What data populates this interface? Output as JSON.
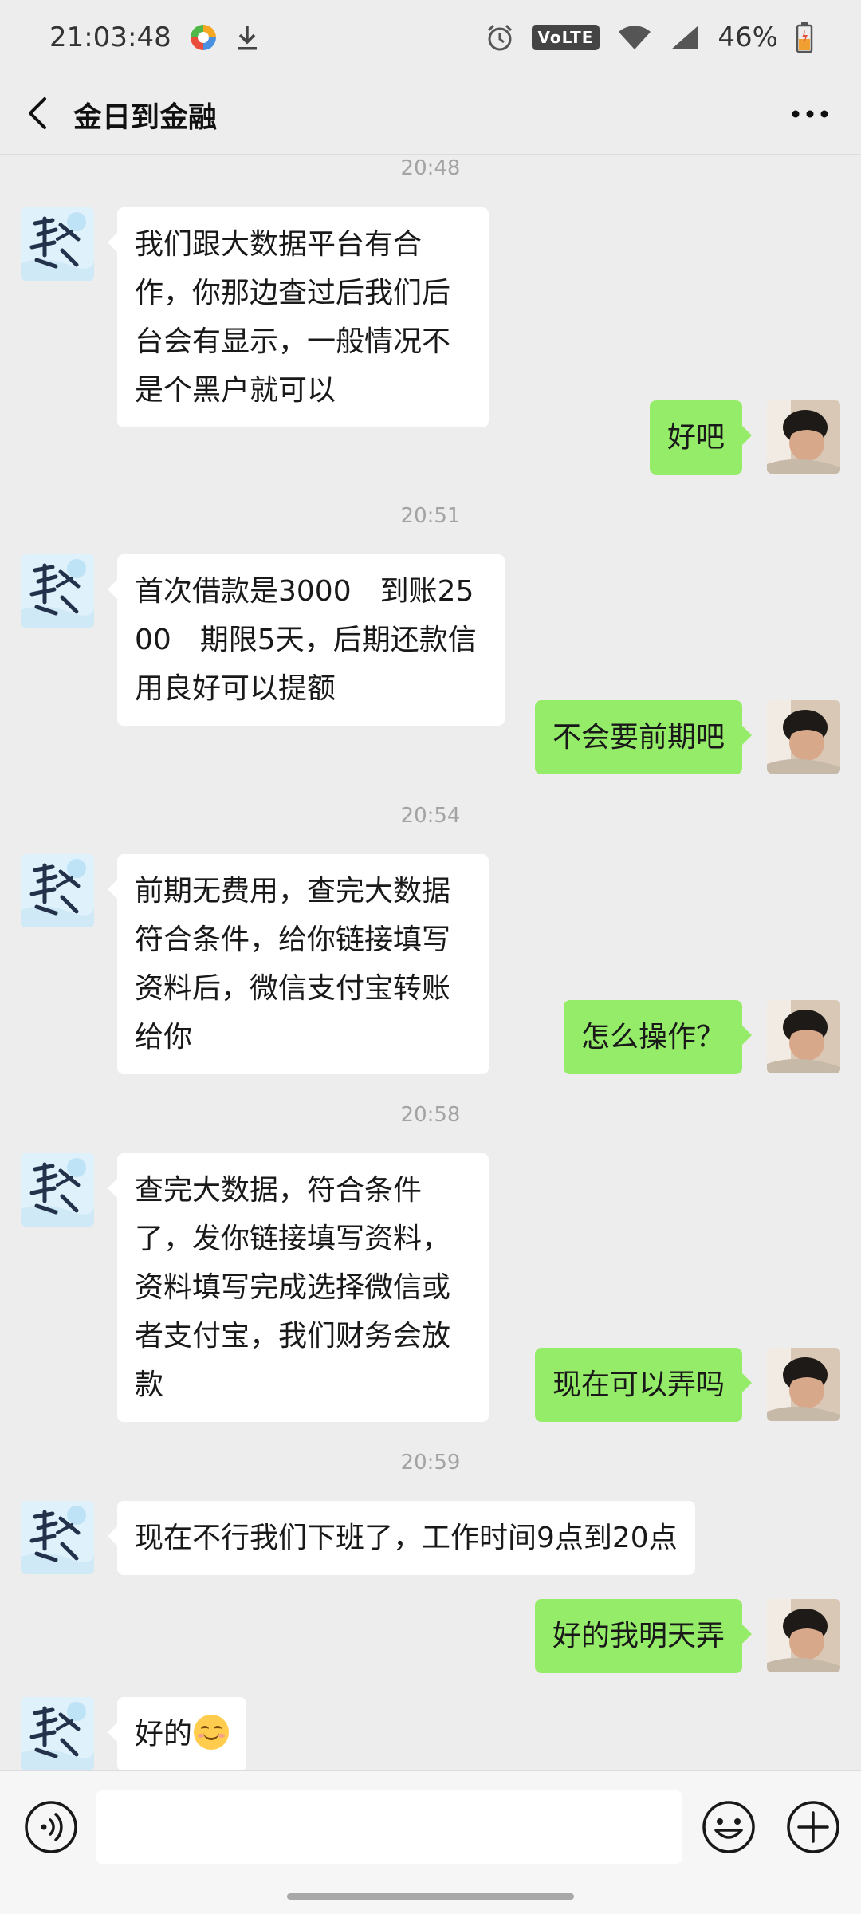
{
  "status_bar": {
    "time": "21:03:48",
    "network_badge": "VoLTE",
    "battery": "46%"
  },
  "header": {
    "title": "金日到金融"
  },
  "messages": [
    {
      "kind": "time",
      "text": "20:48"
    },
    {
      "kind": "msg",
      "sender": "other",
      "text": "我们跟大数据平台有合作，你那边查过后我们后台会有显示，一般情况不是个黑户就可以"
    },
    {
      "kind": "msg",
      "sender": "self",
      "text": "好吧"
    },
    {
      "kind": "time",
      "text": "20:51"
    },
    {
      "kind": "msg",
      "sender": "other",
      "text": "首次借款是3000　到账2500　期限5天，后期还款信用良好可以提额"
    },
    {
      "kind": "msg",
      "sender": "self",
      "text": "不会要前期吧"
    },
    {
      "kind": "time",
      "text": "20:54"
    },
    {
      "kind": "msg",
      "sender": "other",
      "text": "前期无费用，查完大数据符合条件，给你链接填写资料后，微信支付宝转账给你"
    },
    {
      "kind": "msg",
      "sender": "self",
      "text": "怎么操作？"
    },
    {
      "kind": "time",
      "text": "20:58"
    },
    {
      "kind": "msg",
      "sender": "other",
      "text": "查完大数据，符合条件了，发你链接填写资料，资料填写完成选择微信或者支付宝，我们财务会放款"
    },
    {
      "kind": "msg",
      "sender": "self",
      "text": "现在可以弄吗"
    },
    {
      "kind": "time",
      "text": "20:59"
    },
    {
      "kind": "msg",
      "sender": "other",
      "text": "现在不行我们下班了，工作时间9点到20点"
    },
    {
      "kind": "msg",
      "sender": "self",
      "text": "好的我明天弄"
    },
    {
      "kind": "msg",
      "sender": "other",
      "text": "好的",
      "emoji": "smiling-face-emoji"
    }
  ],
  "input": {
    "value": "",
    "placeholder": ""
  },
  "colors": {
    "background": "#ededed",
    "bubble_self": "#95ec69",
    "bubble_other": "#ffffff",
    "timestamp": "#a3a3a3"
  },
  "icons": [
    "back-arrow-icon",
    "more-icon",
    "voice-icon",
    "emoji-icon",
    "plus-icon",
    "alarm-icon",
    "wifi-icon",
    "signal-icon",
    "battery-icon",
    "download-icon",
    "app-notification-icon"
  ]
}
